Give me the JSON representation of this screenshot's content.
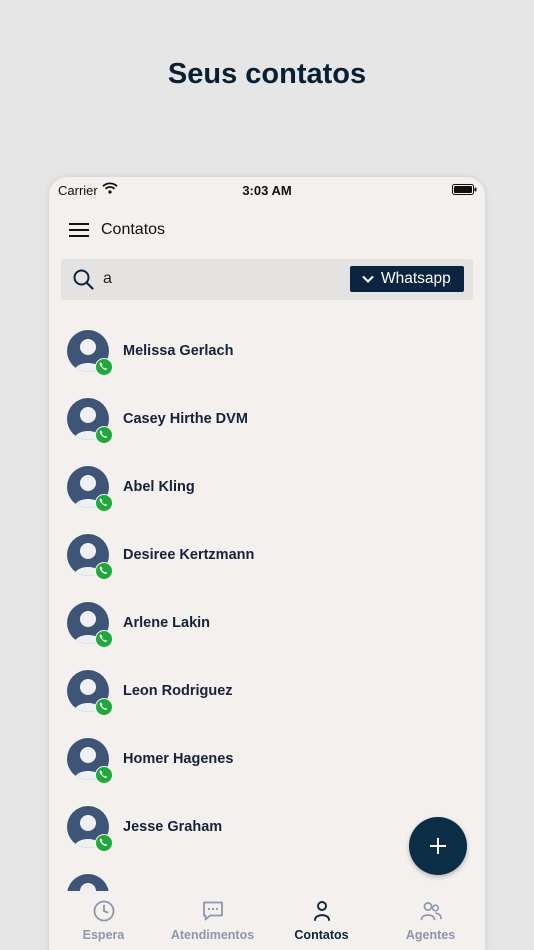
{
  "page": {
    "heading": "Seus contatos"
  },
  "statusbar": {
    "carrier": "Carrier",
    "time": "3:03 AM"
  },
  "appbar": {
    "title": "Contatos"
  },
  "search": {
    "value": "a",
    "channel": "Whatsapp"
  },
  "contacts": [
    {
      "name": "Melissa Gerlach",
      "channel_icon": "whatsapp-icon"
    },
    {
      "name": "Casey Hirthe DVM",
      "channel_icon": "whatsapp-icon"
    },
    {
      "name": "Abel Kling",
      "channel_icon": "whatsapp-icon"
    },
    {
      "name": "Desiree Kertzmann",
      "channel_icon": "whatsapp-icon"
    },
    {
      "name": "Arlene Lakin",
      "channel_icon": "whatsapp-icon"
    },
    {
      "name": "Leon Rodriguez",
      "channel_icon": "whatsapp-icon"
    },
    {
      "name": "Homer Hagenes",
      "channel_icon": "whatsapp-icon"
    },
    {
      "name": "Jesse Graham",
      "channel_icon": "whatsapp-icon"
    },
    {
      "name": "",
      "channel_icon": "whatsapp-icon"
    }
  ],
  "tabs": [
    {
      "label": "Espera",
      "icon": "clock-icon",
      "active": false
    },
    {
      "label": "Atendimentos",
      "icon": "chat-icon",
      "active": false
    },
    {
      "label": "Contatos",
      "icon": "person-icon",
      "active": true
    },
    {
      "label": "Agentes",
      "icon": "people-icon",
      "active": false
    }
  ],
  "colors": {
    "primary": "#0b2540",
    "whatsapp": "#20a93b",
    "avatar": "#3f5577",
    "tab_inactive": "#8b97ac"
  }
}
